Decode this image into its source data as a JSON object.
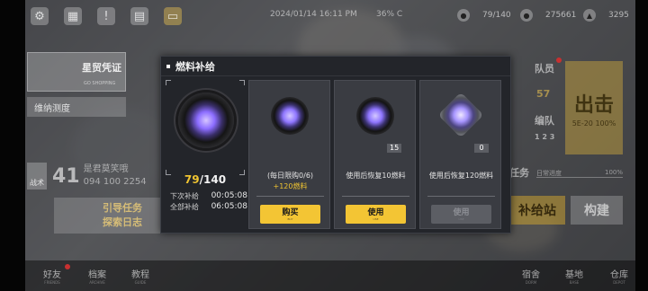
{
  "topbar": {
    "datetime": "2024/01/14 16:11 PM",
    "battery": "36% C",
    "resources": [
      {
        "icon": "fuel-resource-icon",
        "value": "79/140"
      },
      {
        "icon": "coin-resource-icon",
        "value": "275661"
      },
      {
        "icon": "gem-resource-icon",
        "value": "3295"
      }
    ]
  },
  "background": {
    "star_card_title": "星贸凭证",
    "star_card_sub": "GO SHOPPING",
    "weina_title": "维纳测度",
    "war_label": "战术",
    "war_number": "41",
    "war_text1": "是君莫笑哦",
    "war_text2": "094 100 2254",
    "guide_line1": "引导任务",
    "guide_line2": "探索日志",
    "crew_label": "队员",
    "crew_num": "57",
    "team_label": "编队",
    "team_nums": "1 2 3",
    "sortie_title": "出击",
    "sortie_sub": "5E-20 100%",
    "task_label": "任务",
    "daily_label": "日常进度",
    "daily_pct": "100%",
    "supply_station": "补给站",
    "build": "构建"
  },
  "bottombar": {
    "items": [
      {
        "label": "好友",
        "sub": "FRIENDS"
      },
      {
        "label": "档案",
        "sub": "ARCHIVE"
      },
      {
        "label": "教程",
        "sub": "GUIDE"
      },
      {
        "label": "宿舍",
        "sub": "DORM"
      },
      {
        "label": "基地",
        "sub": "BASE"
      },
      {
        "label": "仓库",
        "sub": "DEPOT"
      }
    ]
  },
  "modal": {
    "title": "燃料补给",
    "fuel_current": "79",
    "fuel_sep": "/",
    "fuel_max": "140",
    "next_label": "下次补给",
    "next_time": "00:05:08",
    "full_label": "全部补给",
    "full_time": "06:05:08",
    "options": [
      {
        "icon": "small-fuel-pod-icon",
        "qty": "",
        "desc_line1": "(每日限购0/6)",
        "desc_line2": "+120燃料",
        "button": "购买",
        "button_sub": "BUY",
        "enabled": true
      },
      {
        "icon": "fuel-pod-icon",
        "qty": "15",
        "desc_line1": "使用后恢复10燃料",
        "desc_line2": "",
        "button": "使用",
        "button_sub": "USE",
        "enabled": true
      },
      {
        "icon": "fuel-cube-icon",
        "qty": "0",
        "desc_line1": "使用后恢复120燃料",
        "desc_line2": "",
        "button": "使用",
        "button_sub": "USE",
        "enabled": false
      }
    ]
  },
  "colors": {
    "accent_yellow": "#f3c534",
    "modal_bg": "#23252a",
    "card_bg": "#3a3c42"
  }
}
